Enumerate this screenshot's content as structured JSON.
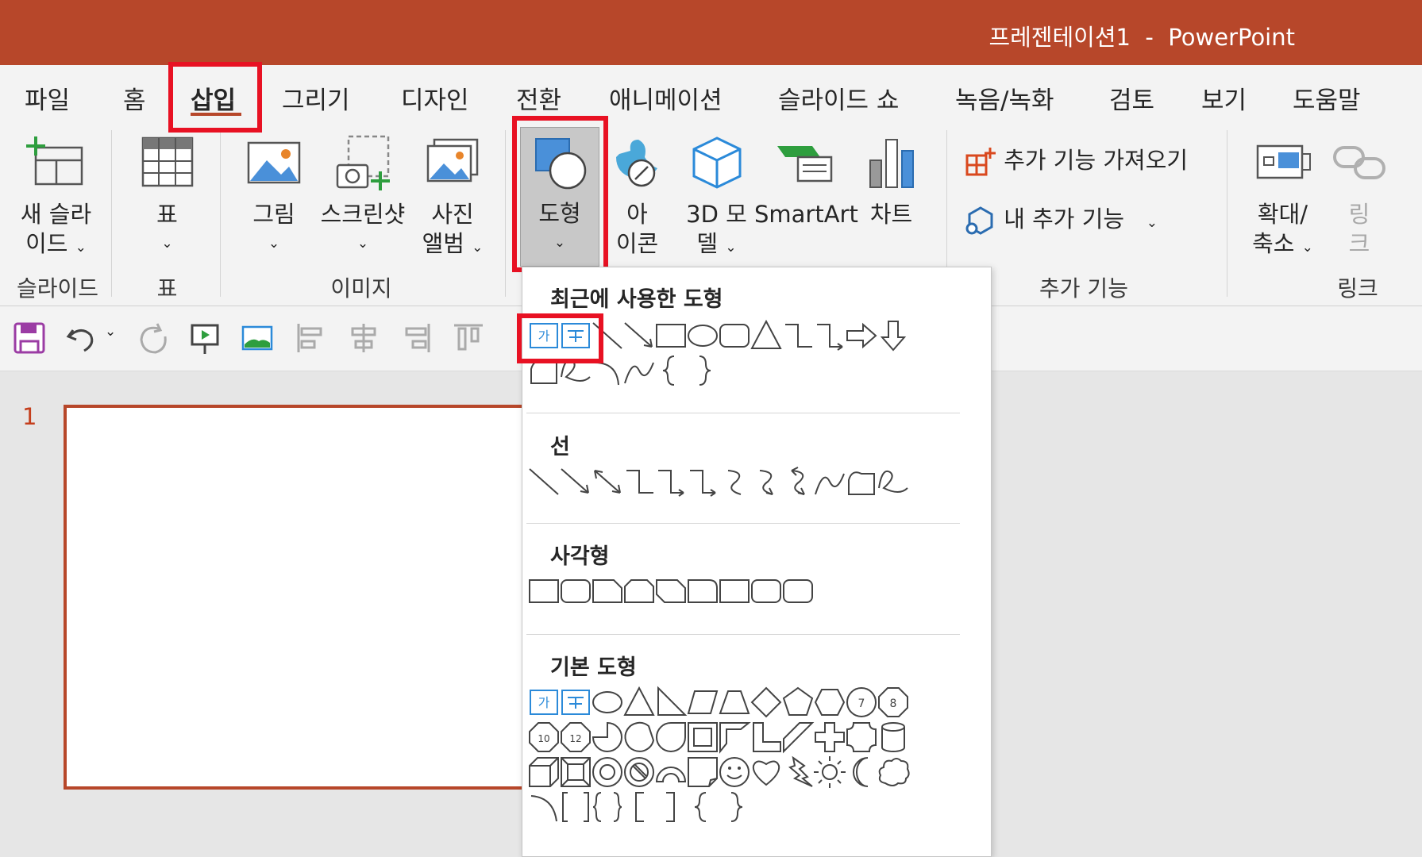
{
  "window": {
    "title": "프레젠테이션1  -  PowerPoint",
    "accent": "#b7472a"
  },
  "tabs": [
    "파일",
    "홈",
    "삽입",
    "그리기",
    "디자인",
    "전환",
    "애니메이션",
    "슬라이드 쇼",
    "녹음/녹화",
    "검토",
    "보기",
    "도움말"
  ],
  "active_tab": "삽입",
  "ribbon": {
    "new_slide": {
      "line1": "새 슬라",
      "line2": "이드"
    },
    "table": {
      "label": "표"
    },
    "picture": {
      "label": "그림"
    },
    "screenshot": {
      "label": "스크린샷"
    },
    "photo_album": {
      "line1": "사진",
      "line2": "앨범"
    },
    "shapes": {
      "label": "도형"
    },
    "icons": {
      "line1": "아",
      "line2": "이콘"
    },
    "model3d": {
      "line1": "3D 모",
      "line2": "델"
    },
    "smartart": {
      "label": "SmartArt"
    },
    "chart": {
      "label": "차트"
    },
    "get_addins": {
      "label": "추가 기능 가져오기"
    },
    "my_addins": {
      "label": "내 추가 기능"
    },
    "zoom": {
      "line1": "확대/",
      "line2": "축소"
    },
    "link": {
      "line1": "링",
      "line2": "크"
    },
    "groups": {
      "slides": "슬라이드",
      "table": "표",
      "images": "이미지",
      "addins": "추가 기능",
      "links": "링크"
    }
  },
  "slide_panel": {
    "number": "1"
  },
  "shapes_menu": {
    "recent_title": "최근에 사용한 도형",
    "lines_title": "선",
    "rect_title": "사각형",
    "basic_title": "기본 도형",
    "textbox_glyph": "가"
  },
  "highlight_color": "#e81123"
}
